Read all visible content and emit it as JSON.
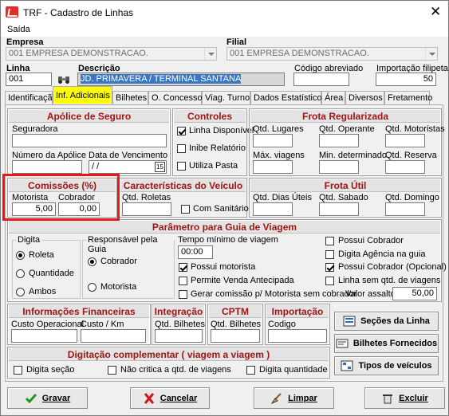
{
  "window": {
    "title": "TRF - Cadastro de Linhas",
    "close_glyph": "✕"
  },
  "menu": {
    "saida": "Saída"
  },
  "empresa": {
    "label": "Empresa",
    "value": "001 EMPRESA DEMONSTRACAO."
  },
  "filial": {
    "label": "Filial",
    "value": "001 EMPRESA DEMONSTRACAO."
  },
  "linha": {
    "label": "Linha",
    "value": "001"
  },
  "descricao": {
    "label": "Descrição",
    "value": "JD. PRIMAVERA / TERMINAL SANTANA"
  },
  "codigo_abreviado": {
    "label": "Código abreviado",
    "value": ""
  },
  "importacao_filipeta": {
    "label": "Importação filipeta",
    "value": "50"
  },
  "tabs": [
    "Identificação",
    "Inf. Adicionais",
    "Bilhetes",
    "O. Concessor",
    "Viag. Turno",
    "Dados Estatísticos",
    "Área",
    "Diversos",
    "Fretamento"
  ],
  "apolice": {
    "title": "Apólice de Seguro",
    "seguradora": "Seguradora",
    "numero": "Número da Apólice",
    "vencimento": "Data de Vencimento",
    "vencimento_value": " / /"
  },
  "controles": {
    "title": "Controles",
    "linha_disponivel": "Linha Disponível",
    "inibe_relatorio": "Inibe Relatório",
    "utiliza_pasta": "Utiliza Pasta"
  },
  "frota_regularizada": {
    "title": "Frota Regularizada",
    "qtd_lugares": "Qtd. Lugares",
    "qtd_operante": "Qtd. Operante",
    "qtd_motoristas": "Qtd. Motoristas",
    "max_viagens": "Máx. viagens",
    "min_determinado": "Min. determinado",
    "qtd_reserva": "Qtd. Reserva"
  },
  "comissoes": {
    "title": "Comissões (%)",
    "motorista": "Motorista",
    "motorista_value": "5,00",
    "cobrador": "Cobrador",
    "cobrador_value": "0,00"
  },
  "caracteristicas": {
    "title": "Características do Veículo",
    "qtd_roletas": "Qtd. Roletas",
    "com_sanitario": "Com Sanitário"
  },
  "frota_util": {
    "title": "Frota Útil",
    "dias_uteis": "Qtd. Dias Úteis",
    "sabado": "Qtd. Sabado",
    "domingo": "Qtd. Domingo"
  },
  "parametro": {
    "title": "Parâmetro para Guia de Viagem",
    "digita": "Digita",
    "roleta": "Roleta",
    "quantidade": "Quantidade",
    "ambos": "Ambos",
    "responsavel": "Responsável pela Guia",
    "cobrador": "Cobrador",
    "motorista": "Motorista",
    "tempo_minimo": "Tempo mínimo de viagem",
    "tempo_value": "00:00",
    "possui_motorista": "Possui motorista",
    "permite_venda": "Permite Venda Antecipada",
    "gerar_comissao": "Gerar comissão p/ Motorista sem cobrador",
    "possui_cobrador": "Possui Cobrador",
    "digita_agencia": "Digita Agência na guia",
    "possui_cobrador_opcional": "Possui Cobrador (Opcional)",
    "linha_sem_qtd": "Linha sem  qtd. de viagens",
    "valor_assalto": "Valor assalto:",
    "valor_assalto_value": "50,00"
  },
  "info_fin": {
    "title": "Informações Financeiras",
    "custo_operacional": "Custo Operacional",
    "custo_km": "Custo / Km"
  },
  "integracao": {
    "title": "Integração",
    "qtd_bilhetes": "Qtd. Bilhetes"
  },
  "cptm": {
    "title": "CPTM",
    "qtd_bilhetes": "Qtd. Bilhetes"
  },
  "importacao": {
    "title": "Importação",
    "codigo": "Codigo"
  },
  "digitacao": {
    "title": "Digitação complementar ( viagem a viagem )",
    "digita_secao": "Digita seção",
    "nao_critica": "Não critica a qtd. de  viagens",
    "digita_quantidade": "Digita quantidade"
  },
  "side_buttons": {
    "secoes": "Seções da Linha",
    "bilhetes": "Bilhetes Fornecidos",
    "tipos": "Tipos de veículos"
  },
  "bottom_buttons": {
    "gravar": "Gravar",
    "cancelar": "Cancelar",
    "limpar": "Limpar",
    "excluir": "Excluir"
  },
  "colors": {
    "header_text": "#a31515",
    "active_tab": "#ffff00",
    "highlight_box": "#e81818",
    "selection": "#3a78c3"
  }
}
